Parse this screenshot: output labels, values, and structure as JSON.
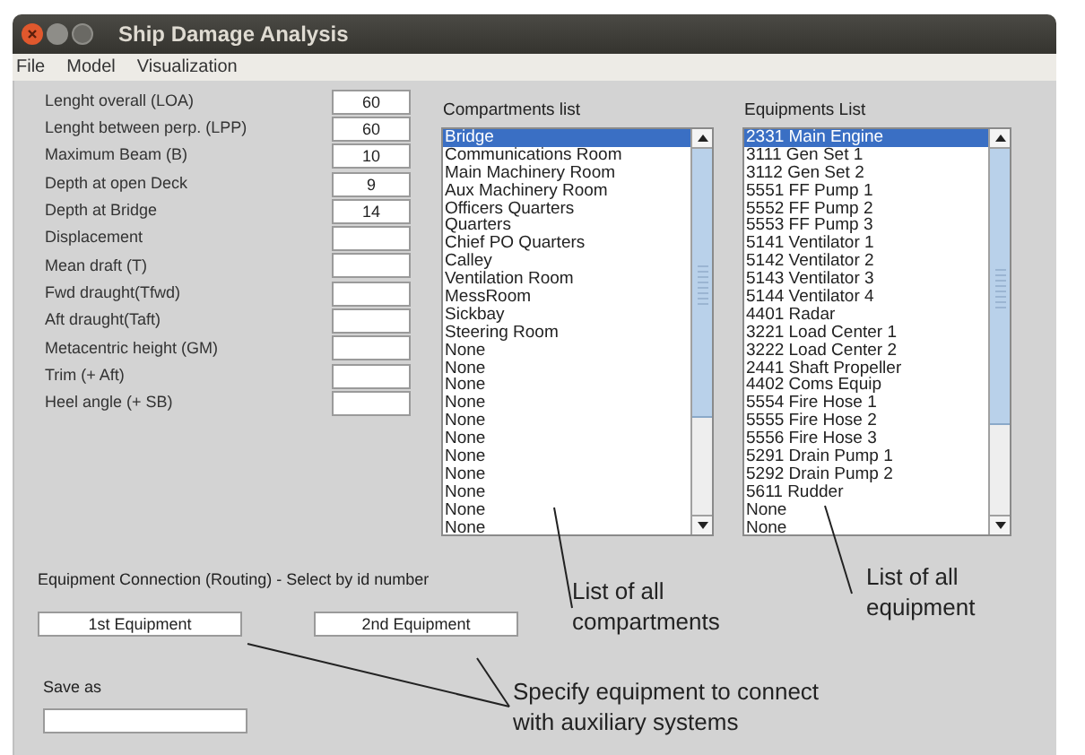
{
  "window": {
    "title": "Ship Damage Analysis"
  },
  "menu": [
    "File",
    "Model",
    "Visualization"
  ],
  "parameters": [
    {
      "label": "Lenght overall (LOA)",
      "value": "60"
    },
    {
      "label": "Lenght between perp. (LPP)",
      "value": "60"
    },
    {
      "label": "Maximum Beam (B)",
      "value": "10"
    },
    {
      "label": "Depth at open Deck",
      "value": "9"
    },
    {
      "label": "Depth at Bridge",
      "value": "14"
    },
    {
      "label": "Displacement"
    },
    {
      "label": "Mean draft (T)"
    },
    {
      "label": "Fwd draught(Tfwd)"
    },
    {
      "label": "Aft draught(Taft)"
    },
    {
      "label": "Metacentric height (GM)"
    },
    {
      "label": "Trim (+ Aft)"
    },
    {
      "label": "Heel angle (+ SB)"
    }
  ],
  "compartments": {
    "title": "Compartments list",
    "items": [
      {
        "label": "Bridge",
        "selected": true
      },
      {
        "label": "Communications Room",
        "selected": false
      },
      {
        "label": "Main Machinery Room",
        "selected": false
      },
      {
        "label": "Aux Machinery Room",
        "selected": false
      },
      {
        "label": "Officers Quarters",
        "selected": false
      },
      {
        "label": "Quarters",
        "selected": false
      },
      {
        "label": "Chief PO Quarters",
        "selected": false
      },
      {
        "label": "Calley",
        "selected": false
      },
      {
        "label": "Ventilation Room",
        "selected": false
      },
      {
        "label": "MessRoom",
        "selected": false
      },
      {
        "label": "Sickbay",
        "selected": false
      },
      {
        "label": "Steering Room",
        "selected": false
      },
      {
        "label": "None",
        "selected": false
      },
      {
        "label": "None",
        "selected": false
      },
      {
        "label": "None",
        "selected": false
      },
      {
        "label": "None",
        "selected": false
      },
      {
        "label": "None",
        "selected": false
      },
      {
        "label": "None",
        "selected": false
      },
      {
        "label": "None",
        "selected": false
      },
      {
        "label": "None",
        "selected": false
      },
      {
        "label": "None",
        "selected": false
      },
      {
        "label": "None",
        "selected": false
      },
      {
        "label": "None",
        "selected": false
      }
    ]
  },
  "equipments": {
    "title": "Equipments List",
    "items": [
      {
        "label": "2331 Main Engine",
        "selected": true
      },
      {
        "label": "3111 Gen Set 1",
        "selected": false
      },
      {
        "label": "3112 Gen Set 2",
        "selected": false
      },
      {
        "label": "5551 FF Pump 1",
        "selected": false
      },
      {
        "label": "5552 FF Pump 2",
        "selected": false
      },
      {
        "label": "5553 FF Pump 3",
        "selected": false
      },
      {
        "label": "5141 Ventilator 1",
        "selected": false
      },
      {
        "label": "5142 Ventilator 2",
        "selected": false
      },
      {
        "label": "5143 Ventilator 3",
        "selected": false
      },
      {
        "label": "5144 Ventilator 4",
        "selected": false
      },
      {
        "label": "4401 Radar",
        "selected": false
      },
      {
        "label": "3221 Load Center 1",
        "selected": false
      },
      {
        "label": "3222 Load Center 2",
        "selected": false
      },
      {
        "label": "2441 Shaft Propeller",
        "selected": false
      },
      {
        "label": "4402 Coms Equip",
        "selected": false
      },
      {
        "label": "5554 Fire Hose 1",
        "selected": false
      },
      {
        "label": "5555 Fire Hose 2",
        "selected": false
      },
      {
        "label": "5556 Fire Hose 3",
        "selected": false
      },
      {
        "label": "5291 Drain Pump 1",
        "selected": false
      },
      {
        "label": "5292 Drain Pump 2",
        "selected": false
      },
      {
        "label": "5611 Rudder",
        "selected": false
      },
      {
        "label": "None",
        "selected": false
      },
      {
        "label": "None",
        "selected": false
      }
    ]
  },
  "routing": {
    "title": "Equipment Connection (Routing) - Select by id number",
    "first": "1st Equipment",
    "second": "2nd Equipment"
  },
  "save": {
    "label": "Save as"
  },
  "annotations": [
    {
      "text": "List of all compartments"
    },
    {
      "text": "List of all equipment"
    },
    {
      "text": "Specify equipment to connect with auxiliary systems"
    }
  ]
}
